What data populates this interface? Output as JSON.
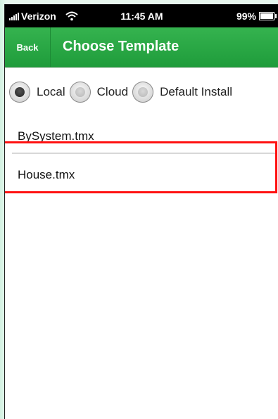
{
  "status_bar": {
    "carrier": "Verizon",
    "time": "11:45 AM",
    "battery": "99%"
  },
  "nav": {
    "back_label": "Back",
    "title": "Choose Template"
  },
  "source_options": [
    {
      "label": "Local",
      "checked": true
    },
    {
      "label": "Cloud",
      "checked": false
    },
    {
      "label": "Default Install",
      "checked": false
    }
  ],
  "templates": [
    {
      "name": "BySystem.tmx"
    },
    {
      "name": "House.tmx",
      "highlighted": true
    }
  ],
  "colors": {
    "nav_green": "#23a33f",
    "highlight_red": "#ff1111"
  }
}
